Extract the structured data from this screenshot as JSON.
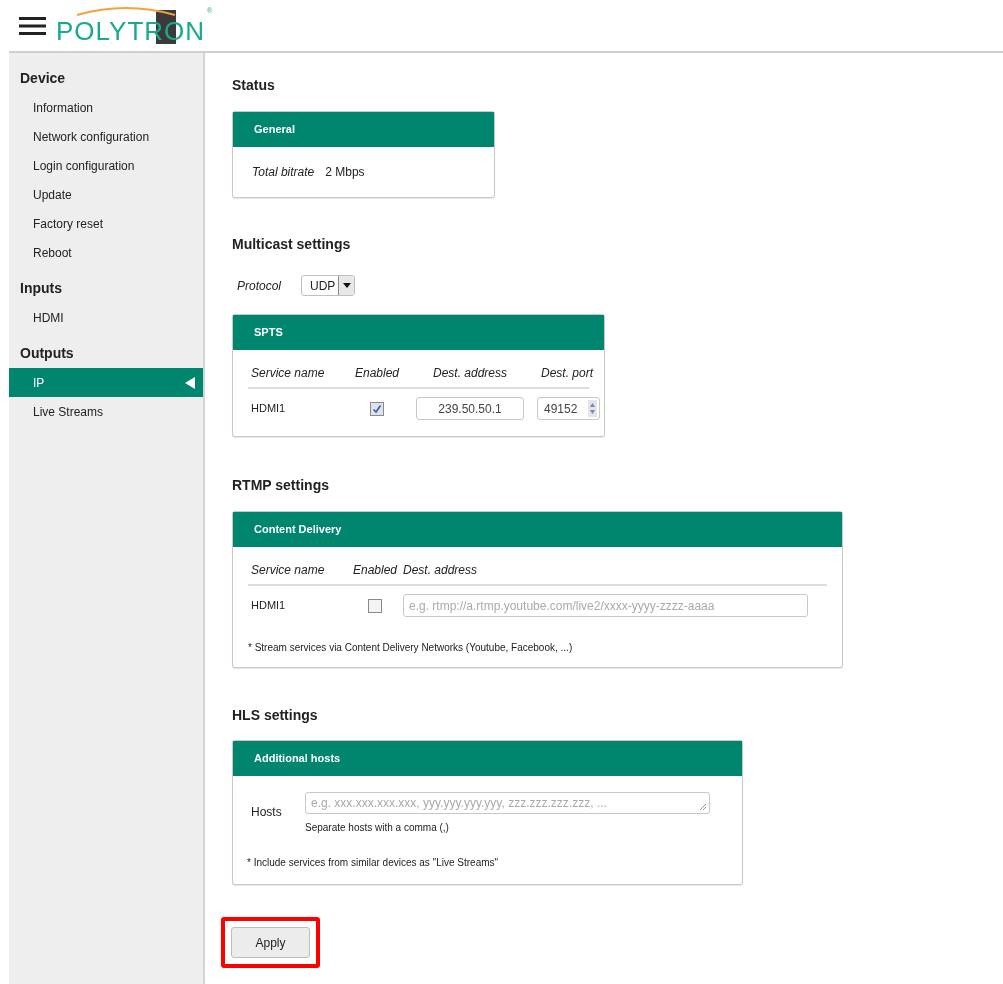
{
  "header": {
    "logo": "POLYTRON",
    "registered": "®"
  },
  "sidebar": {
    "sections": [
      {
        "title": "Device",
        "items": [
          {
            "label": "Information",
            "selected": false
          },
          {
            "label": "Network configuration",
            "selected": false
          },
          {
            "label": "Login configuration",
            "selected": false
          },
          {
            "label": "Update",
            "selected": false
          },
          {
            "label": "Factory reset",
            "selected": false
          },
          {
            "label": "Reboot",
            "selected": false
          }
        ]
      },
      {
        "title": "Inputs",
        "items": [
          {
            "label": "HDMI",
            "selected": false
          }
        ]
      },
      {
        "title": "Outputs",
        "items": [
          {
            "label": "IP",
            "selected": true
          },
          {
            "label": "Live Streams",
            "selected": false
          }
        ]
      }
    ]
  },
  "status": {
    "title": "Status",
    "card": {
      "title": "General",
      "label": "Total bitrate",
      "value": "2 Mbps"
    }
  },
  "multicast": {
    "title": "Multicast settings",
    "protocol_label": "Protocol",
    "protocol_value": "UDP",
    "card": {
      "title": "SPTS",
      "columns": [
        "Service name",
        "Enabled",
        "Dest. address",
        "Dest. port"
      ],
      "rows": [
        {
          "name": "HDMI1",
          "enabled": true,
          "address": "239.50.50.1",
          "port": "49152"
        }
      ]
    }
  },
  "rtmp": {
    "title": "RTMP settings",
    "card": {
      "title": "Content Delivery",
      "columns": [
        "Service name",
        "Enabled",
        "Dest. address"
      ],
      "rows": [
        {
          "name": "HDMI1",
          "enabled": false,
          "placeholder": "e.g. rtmp://a.rtmp.youtube.com/live2/xxxx-yyyy-zzzz-aaaa"
        }
      ],
      "note": "* Stream services via Content Delivery Networks (Youtube, Facebook, ...)"
    }
  },
  "hls": {
    "title": "HLS settings",
    "card": {
      "title": "Additional hosts",
      "label": "Hosts",
      "placeholder": "e.g. xxx.xxx.xxx.xxx, yyy.yyy.yyy.yyy, zzz.zzz.zzz.zzz, ...",
      "hint": "Separate hosts with a comma (,)",
      "note": "* Include services from similar devices as \"Live Streams\""
    }
  },
  "apply": {
    "label": "Apply",
    "highlighted": true
  }
}
